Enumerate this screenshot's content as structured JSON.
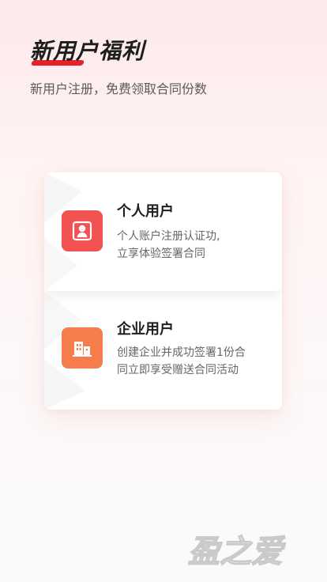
{
  "header": {
    "title": "新用户福利",
    "subtitle": "新用户注册，免费领取合同份数"
  },
  "cards": [
    {
      "title": "个人用户",
      "description_line1": "个人账户注册认证功,",
      "description_line2": "立享体验签署合同",
      "icon": "user-icon",
      "color": "#f25252"
    },
    {
      "title": "企业用户",
      "description_line1": "创建企业并成功签署1份合",
      "description_line2": "同立即享受赠送合同活动",
      "icon": "building-icon",
      "color": "#f57d4b"
    }
  ],
  "watermark": {
    "text": "盈之爱"
  },
  "theme": {
    "accent": "#e3222c",
    "text_primary": "#1d1d1d",
    "text_secondary": "#666666"
  }
}
